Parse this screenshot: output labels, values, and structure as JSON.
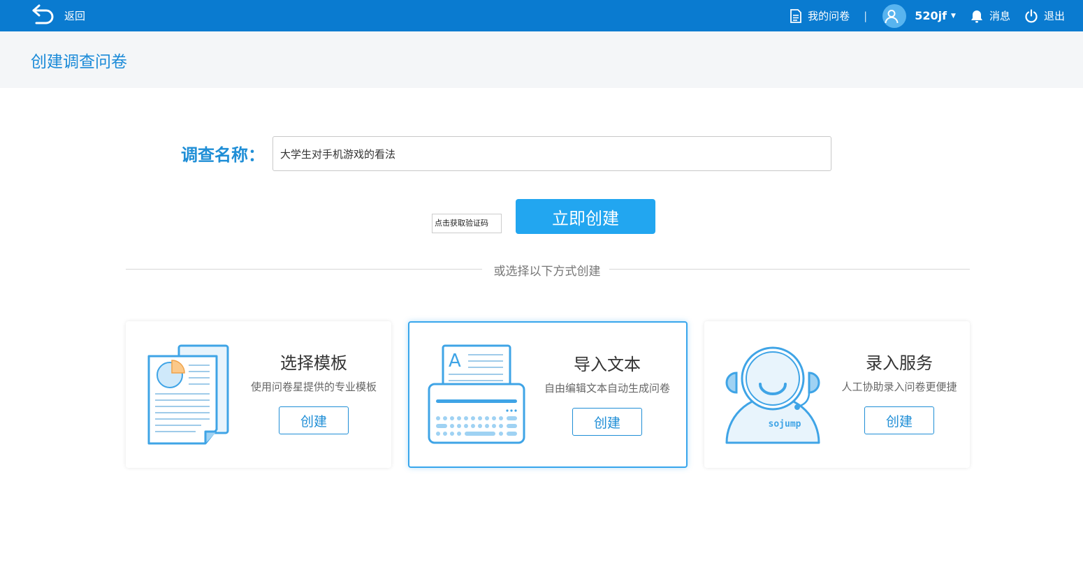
{
  "topbar": {
    "back_label": "返回",
    "my_surveys_label": "我的问卷",
    "separator": "|",
    "username": "520jf",
    "messages_label": "消息",
    "logout_label": "退出",
    "bg_color": "#0a7bd0"
  },
  "page": {
    "title": "创建调查问卷"
  },
  "survey_form": {
    "name_label": "调查名称：",
    "name_value": "大学生对手机游戏的看法",
    "captcha_label": "点击获取验证码",
    "create_now_label": "立即创建"
  },
  "divider_text": "或选择以下方式创建",
  "cards": [
    {
      "icon": "template-document-icon",
      "title": "选择模板",
      "desc": "使用问卷星提供的专业模板",
      "button": "创建"
    },
    {
      "icon": "import-text-typewriter-icon",
      "title": "导入文本",
      "desc": "自由编辑文本自动生成问卷",
      "button": "创建"
    },
    {
      "icon": "entry-service-agent-icon",
      "title": "录入服务",
      "desc": "人工协助录入问卷更便捷",
      "button": "创建",
      "illustration_text": "sojump"
    }
  ],
  "colors": {
    "accent": "#1f8ed6",
    "primary_button": "#22a6f0",
    "icon_blue": "#3fa4e6"
  }
}
